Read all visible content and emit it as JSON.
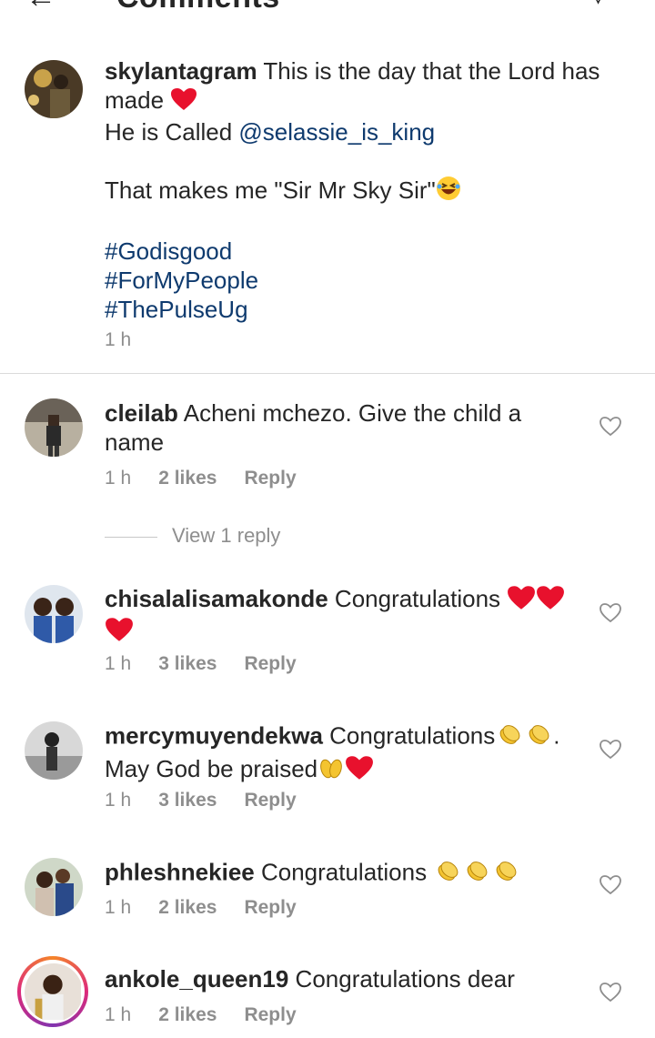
{
  "header": {
    "back_icon": "arrow-left-icon",
    "title": "Comments",
    "send_icon": "send-icon"
  },
  "caption": {
    "username": "skylantagram",
    "line1": " This is the day that the Lord has made ",
    "line2_prefix": "He is Called ",
    "mention": "@selassie_is_king",
    "line3": "That makes me \"Sir Mr Sky Sir\"",
    "hashtags": [
      "#Godisgood",
      "#ForMyPeople",
      "#ThePulseUg"
    ],
    "time": "1 h"
  },
  "comments": [
    {
      "username": "cleilab",
      "text": " Acheni mchezo. Give the child a name",
      "time": "1 h",
      "likes": "2 likes",
      "reply": "Reply"
    },
    {
      "username": "chisalalisamakonde",
      "text": " Congratulations ",
      "time": "1 h",
      "likes": "3 likes",
      "reply": "Reply"
    },
    {
      "username": "mercymuyendekwa",
      "text": " Congratulations",
      "text2": ".",
      "text3": "May God be praised",
      "time": "1 h",
      "likes": "3 likes",
      "reply": "Reply"
    },
    {
      "username": "phleshnekiee",
      "text": " Congratulations ",
      "time": "1 h",
      "likes": "2 likes",
      "reply": "Reply"
    },
    {
      "username": "ankole_queen19",
      "text": " Congratulations dear",
      "time": "1 h",
      "likes": "2 likes",
      "reply": "Reply"
    }
  ],
  "view_replies": "View 1 reply",
  "colors": {
    "link": "#0e3a6e",
    "meta": "#8e8e8e",
    "heart": "#e8112d",
    "clap": "#f4c430"
  }
}
